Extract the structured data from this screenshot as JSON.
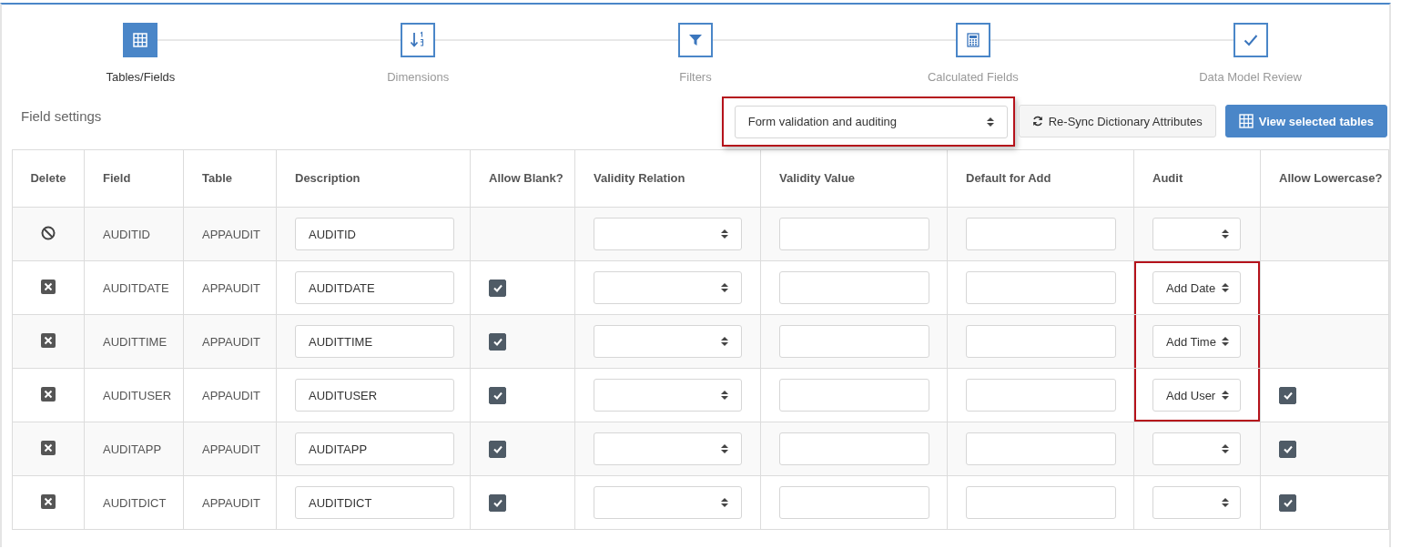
{
  "steps": [
    {
      "label": "Tables/Fields",
      "selected": true
    },
    {
      "label": "Dimensions",
      "selected": false
    },
    {
      "label": "Filters",
      "selected": false
    },
    {
      "label": "Calculated Fields",
      "selected": false
    },
    {
      "label": "Data Model Review",
      "selected": false
    }
  ],
  "section_title": "Field settings",
  "mode_select": {
    "value": "Form validation and auditing",
    "highlighted": true
  },
  "resync_button": "Re-Sync Dictionary Attributes",
  "view_button": "View selected tables",
  "table": {
    "columns": [
      "Delete",
      "Field",
      "Table",
      "Description",
      "Allow Blank?",
      "Validity Relation",
      "Validity Value",
      "Default for Add",
      "Audit",
      "Allow Lowercase?"
    ],
    "rows": [
      {
        "kind": "locked",
        "field": "AUDITID",
        "table": "APPAUDIT",
        "description": "AUDITID",
        "allow_blank": false,
        "audit": "",
        "audit_highlighted": false,
        "allow_lowercase": false
      },
      {
        "kind": "removable",
        "field": "AUDITDATE",
        "table": "APPAUDIT",
        "description": "AUDITDATE",
        "allow_blank": true,
        "audit": "Add Date",
        "audit_highlighted": true,
        "allow_lowercase": false
      },
      {
        "kind": "removable",
        "field": "AUDITTIME",
        "table": "APPAUDIT",
        "description": "AUDITTIME",
        "allow_blank": true,
        "audit": "Add Time",
        "audit_highlighted": true,
        "allow_lowercase": false
      },
      {
        "kind": "removable",
        "field": "AUDITUSER",
        "table": "APPAUDIT",
        "description": "AUDITUSER",
        "allow_blank": true,
        "audit": "Add User",
        "audit_highlighted": true,
        "allow_lowercase": true
      },
      {
        "kind": "removable",
        "field": "AUDITAPP",
        "table": "APPAUDIT",
        "description": "AUDITAPP",
        "allow_blank": true,
        "audit": "",
        "audit_highlighted": false,
        "allow_lowercase": true
      },
      {
        "kind": "removable",
        "field": "AUDITDICT",
        "table": "APPAUDIT",
        "description": "AUDITDICT",
        "allow_blank": true,
        "audit": "",
        "audit_highlighted": false,
        "allow_lowercase": true
      }
    ]
  }
}
